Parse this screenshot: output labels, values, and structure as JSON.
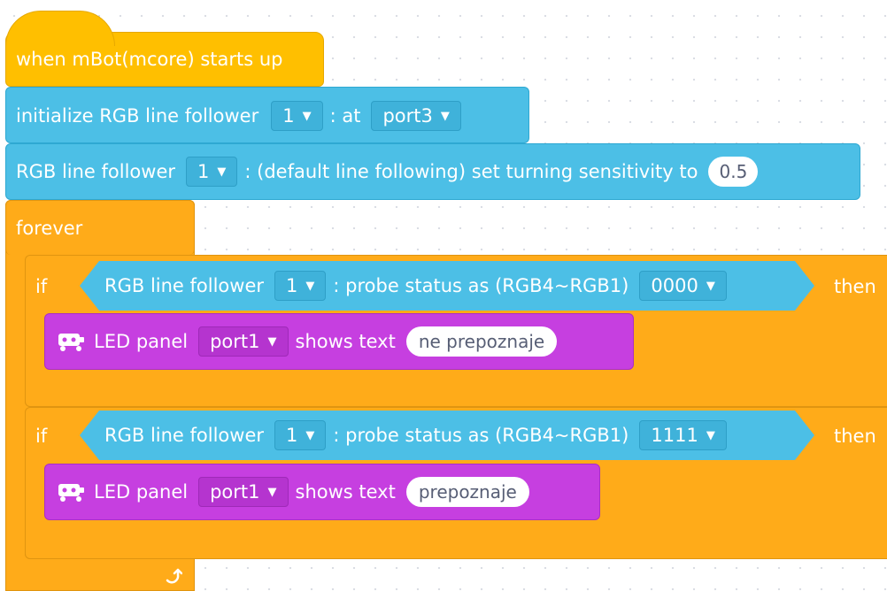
{
  "hat": {
    "label": "when mBot(mcore) starts up"
  },
  "init": {
    "label": "initialize RGB line follower",
    "index": "1",
    "at_label": ": at",
    "port": "port3"
  },
  "sensitivity": {
    "label": "RGB line follower",
    "index": "1",
    "text": ": (default line following) set turning sensitivity to",
    "value": "0.5"
  },
  "forever": {
    "label": "forever"
  },
  "if_blocks": [
    {
      "if_label": "if",
      "cond_label": "RGB line follower",
      "index": "1",
      "probe_text": ": probe status as (RGB4~RGB1)",
      "status": "0000",
      "then_label": "then",
      "led": {
        "label": "LED panel",
        "port": "port1",
        "shows_text": "shows text",
        "text": "ne prepoznaje"
      }
    },
    {
      "if_label": "if",
      "cond_label": "RGB line follower",
      "index": "1",
      "probe_text": ": probe status as (RGB4~RGB1)",
      "status": "1111",
      "then_label": "then",
      "led": {
        "label": "LED panel",
        "port": "port1",
        "shows_text": "shows text",
        "text": "prepoznaje"
      }
    }
  ],
  "colors": {
    "event": "#FFBF00",
    "sensor": "#4CBFE6",
    "control": "#FFAB19",
    "looks": "#C63FE0"
  },
  "icons": {
    "dropdown": "caret-down-icon",
    "led": "robot-icon",
    "loop": "loop-arrow-icon"
  }
}
